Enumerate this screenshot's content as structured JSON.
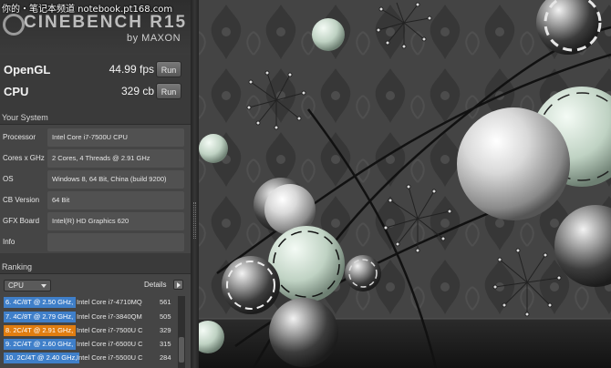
{
  "watermark": "你的・笔记本频道 notebook.pt168.com",
  "app": {
    "logo_text": "CINEBENCH R15",
    "logo_by": "by MAXON"
  },
  "scores": [
    {
      "label": "OpenGL",
      "value": "44.99 fps",
      "button": "Run"
    },
    {
      "label": "CPU",
      "value": "329 cb",
      "button": "Run"
    }
  ],
  "system": {
    "title": "Your System",
    "rows": [
      {
        "label": "Processor",
        "value": "Intel Core i7-7500U CPU"
      },
      {
        "label": "Cores x GHz",
        "value": "2 Cores, 4 Threads @ 2.91 GHz"
      },
      {
        "label": "OS",
        "value": "Windows 8, 64 Bit, China (build 9200)"
      },
      {
        "label": "CB Version",
        "value": "64 Bit"
      },
      {
        "label": "GFX Board",
        "value": "Intel(R) HD Graphics 620"
      },
      {
        "label": "Info",
        "value": ""
      }
    ]
  },
  "ranking": {
    "title": "Ranking",
    "select_value": "CPU",
    "details_label": "Details",
    "rows": [
      {
        "tag": "6. 4C/8T @ 2.50 GHz,",
        "desc": "Intel Core i7-4710MQ",
        "score": "561",
        "tag_color": "#3f7fc9",
        "highlight": false
      },
      {
        "tag": "7. 4C/8T @ 2.79 GHz,",
        "desc": "Intel Core i7-3840QM",
        "score": "505",
        "tag_color": "#3f7fc9",
        "highlight": false
      },
      {
        "tag": "8. 2C/4T @ 2.91 GHz,",
        "desc": "Intel Core i7-7500U C",
        "score": "329",
        "tag_color": "#e07d10",
        "highlight": true
      },
      {
        "tag": "9. 2C/4T @ 2.60 GHz,",
        "desc": "Intel Core i7-6500U C",
        "score": "315",
        "tag_color": "#3f7fc9",
        "highlight": false
      },
      {
        "tag": "10. 2C/4T @ 2.40 GHz,",
        "desc": "Intel Core i7-5500U C",
        "score": "284",
        "tag_color": "#3f7fc9",
        "highlight": false
      }
    ]
  }
}
